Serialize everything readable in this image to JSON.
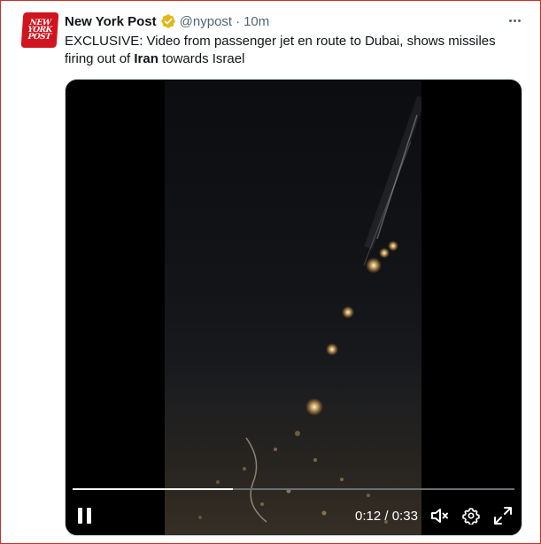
{
  "tweet": {
    "avatar_lines": [
      "NEW",
      "YORK",
      "POST"
    ],
    "display_name": "New York Post",
    "handle": "@nypost",
    "separator": "·",
    "timestamp": "10m",
    "text_before": "EXCLUSIVE: Video from passenger jet en route to Dubai, shows missiles firing out of ",
    "text_bold": "Iran",
    "text_after": " towards Israel",
    "verified_color": "#e2b719",
    "brand_color": "#d0151f"
  },
  "video": {
    "current_time": "0:12",
    "time_separator": " / ",
    "duration": "0:33",
    "progress": 0.3636,
    "icons": {
      "play_state": "pause-icon",
      "mute": "mute-icon",
      "settings": "gear-icon",
      "fullscreen": "fullscreen-icon"
    }
  }
}
